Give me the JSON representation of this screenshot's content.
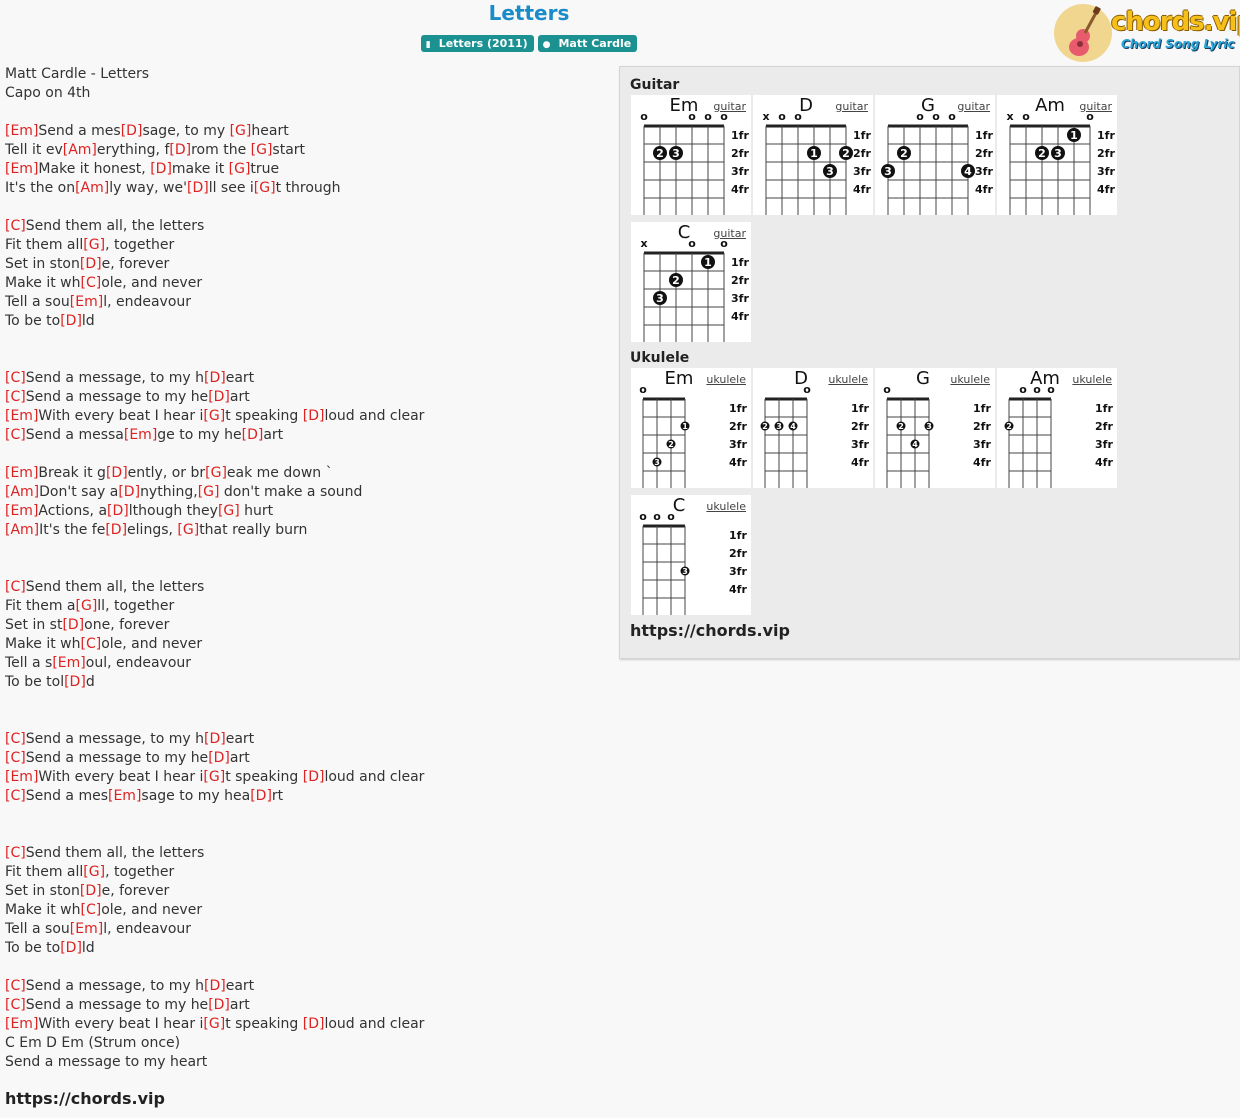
{
  "page": {
    "title": "Letters",
    "tags": [
      {
        "icon": "book-icon",
        "label": "Letters (2011)"
      },
      {
        "icon": "person-icon",
        "label": "Matt Cardle"
      }
    ],
    "logo": {
      "text": "chords.vip",
      "subtitle": "Chord Song Lyric"
    }
  },
  "lyrics": {
    "lines": [
      [
        {
          "t": "Matt Cardle - Letters"
        }
      ],
      [
        {
          "t": "Capo on 4th"
        }
      ],
      [],
      [
        {
          "c": "[Em]"
        },
        {
          "t": "Send a mes"
        },
        {
          "c": "[D]"
        },
        {
          "t": "sage, to my "
        },
        {
          "c": "[G]"
        },
        {
          "t": "heart"
        }
      ],
      [
        {
          "t": "Tell it ev"
        },
        {
          "c": "[Am]"
        },
        {
          "t": "erything, f"
        },
        {
          "c": "[D]"
        },
        {
          "t": "rom the "
        },
        {
          "c": "[G]"
        },
        {
          "t": "start"
        }
      ],
      [
        {
          "c": "[Em]"
        },
        {
          "t": "Make it honest, "
        },
        {
          "c": "[D]"
        },
        {
          "t": "make it "
        },
        {
          "c": "[G]"
        },
        {
          "t": "true"
        }
      ],
      [
        {
          "t": "It's the on"
        },
        {
          "c": "[Am]"
        },
        {
          "t": "ly way, we'"
        },
        {
          "c": "[D]"
        },
        {
          "t": "ll see i"
        },
        {
          "c": "[G]"
        },
        {
          "t": "t through"
        }
      ],
      [],
      [
        {
          "c": "[C]"
        },
        {
          "t": "Send them all, the letters"
        }
      ],
      [
        {
          "t": "Fit them all"
        },
        {
          "c": "[G]"
        },
        {
          "t": ", together"
        }
      ],
      [
        {
          "t": "Set in ston"
        },
        {
          "c": "[D]"
        },
        {
          "t": "e, forever"
        }
      ],
      [
        {
          "t": "Make it wh"
        },
        {
          "c": "[C]"
        },
        {
          "t": "ole, and never"
        }
      ],
      [
        {
          "t": "Tell a sou"
        },
        {
          "c": "[Em]"
        },
        {
          "t": "l, endeavour"
        }
      ],
      [
        {
          "t": "To be to"
        },
        {
          "c": "[D]"
        },
        {
          "t": "ld"
        }
      ],
      [],
      [],
      [
        {
          "c": "[C]"
        },
        {
          "t": "Send a message, to my h"
        },
        {
          "c": "[D]"
        },
        {
          "t": "eart"
        }
      ],
      [
        {
          "c": "[C]"
        },
        {
          "t": "Send a message to my he"
        },
        {
          "c": "[D]"
        },
        {
          "t": "art"
        }
      ],
      [
        {
          "c": "[Em]"
        },
        {
          "t": "With every beat I hear i"
        },
        {
          "c": "[G]"
        },
        {
          "t": "t speaking "
        },
        {
          "c": "[D]"
        },
        {
          "t": "loud and clear"
        }
      ],
      [
        {
          "c": "[C]"
        },
        {
          "t": "Send a messa"
        },
        {
          "c": "[Em]"
        },
        {
          "t": "ge to my he"
        },
        {
          "c": "[D]"
        },
        {
          "t": "art"
        }
      ],
      [],
      [
        {
          "c": "[Em]"
        },
        {
          "t": "Break it g"
        },
        {
          "c": "[D]"
        },
        {
          "t": "ently, or br"
        },
        {
          "c": "[G]"
        },
        {
          "t": "eak me down `"
        }
      ],
      [
        {
          "c": "[Am]"
        },
        {
          "t": "Don't say a"
        },
        {
          "c": "[D]"
        },
        {
          "t": "nything,"
        },
        {
          "c": "[G]"
        },
        {
          "t": " don't make a sound"
        }
      ],
      [
        {
          "c": "[Em]"
        },
        {
          "t": "Actions, a"
        },
        {
          "c": "[D]"
        },
        {
          "t": "lthough they"
        },
        {
          "c": "[G]"
        },
        {
          "t": " hurt"
        }
      ],
      [
        {
          "c": "[Am]"
        },
        {
          "t": "It's the fe"
        },
        {
          "c": "[D]"
        },
        {
          "t": "elings, "
        },
        {
          "c": "[G]"
        },
        {
          "t": "that really burn"
        }
      ],
      [],
      [],
      [
        {
          "c": "[C]"
        },
        {
          "t": "Send them all, the letters"
        }
      ],
      [
        {
          "t": "Fit them a"
        },
        {
          "c": "[G]"
        },
        {
          "t": "ll, together"
        }
      ],
      [
        {
          "t": "Set in st"
        },
        {
          "c": "[D]"
        },
        {
          "t": "one, forever"
        }
      ],
      [
        {
          "t": "Make it wh"
        },
        {
          "c": "[C]"
        },
        {
          "t": "ole, and never"
        }
      ],
      [
        {
          "t": "Tell a s"
        },
        {
          "c": "[Em]"
        },
        {
          "t": "oul, endeavour"
        }
      ],
      [
        {
          "t": "To be tol"
        },
        {
          "c": "[D]"
        },
        {
          "t": "d"
        }
      ],
      [],
      [],
      [
        {
          "c": "[C]"
        },
        {
          "t": "Send a message, to my h"
        },
        {
          "c": "[D]"
        },
        {
          "t": "eart"
        }
      ],
      [
        {
          "c": "[C]"
        },
        {
          "t": "Send a message to my he"
        },
        {
          "c": "[D]"
        },
        {
          "t": "art"
        }
      ],
      [
        {
          "c": "[Em]"
        },
        {
          "t": "With every beat I hear i"
        },
        {
          "c": "[G]"
        },
        {
          "t": "t speaking "
        },
        {
          "c": "[D]"
        },
        {
          "t": "loud and clear"
        }
      ],
      [
        {
          "c": "[C]"
        },
        {
          "t": "Send a mes"
        },
        {
          "c": "[Em]"
        },
        {
          "t": "sage to my hea"
        },
        {
          "c": "[D]"
        },
        {
          "t": "rt"
        }
      ],
      [],
      [],
      [
        {
          "c": "[C]"
        },
        {
          "t": "Send them all, the letters"
        }
      ],
      [
        {
          "t": "Fit them all"
        },
        {
          "c": "[G]"
        },
        {
          "t": ", together"
        }
      ],
      [
        {
          "t": "Set in ston"
        },
        {
          "c": "[D]"
        },
        {
          "t": "e, forever"
        }
      ],
      [
        {
          "t": "Make it wh"
        },
        {
          "c": "[C]"
        },
        {
          "t": "ole, and never"
        }
      ],
      [
        {
          "t": "Tell a sou"
        },
        {
          "c": "[Em]"
        },
        {
          "t": "l, endeavour"
        }
      ],
      [
        {
          "t": "To be to"
        },
        {
          "c": "[D]"
        },
        {
          "t": "ld"
        }
      ],
      [],
      [
        {
          "c": "[C]"
        },
        {
          "t": "Send a message, to my h"
        },
        {
          "c": "[D]"
        },
        {
          "t": "eart"
        }
      ],
      [
        {
          "c": "[C]"
        },
        {
          "t": "Send a message to my he"
        },
        {
          "c": "[D]"
        },
        {
          "t": "art"
        }
      ],
      [
        {
          "c": "[Em]"
        },
        {
          "t": "With every beat I hear i"
        },
        {
          "c": "[G]"
        },
        {
          "t": "t speaking "
        },
        {
          "c": "[D]"
        },
        {
          "t": "loud and clear"
        }
      ],
      [
        {
          "t": "C Em D Em (Strum once)"
        }
      ],
      [
        {
          "t": "Send a message to my heart"
        }
      ]
    ],
    "footer_url": "https://chords.vip"
  },
  "diagrams": {
    "guitar_label": "Guitar",
    "ukulele_label": "Ukulele",
    "fret_labels": [
      "1fr",
      "2fr",
      "3fr",
      "4fr"
    ],
    "guitar": [
      {
        "name": "Em",
        "kind": "guitar",
        "markers": [
          "o",
          "",
          "",
          "o",
          "o",
          "o"
        ],
        "dots": [
          [
            1,
            2,
            "2"
          ],
          [
            2,
            2,
            "3"
          ]
        ]
      },
      {
        "name": "D",
        "kind": "guitar",
        "markers": [
          "x",
          "o",
          "o",
          "",
          "",
          ""
        ],
        "dots": [
          [
            3,
            2,
            "1"
          ],
          [
            5,
            2,
            "2"
          ],
          [
            4,
            3,
            "3"
          ]
        ]
      },
      {
        "name": "G",
        "kind": "guitar",
        "markers": [
          "",
          "",
          "o",
          "o",
          "o",
          ""
        ],
        "dots": [
          [
            1,
            2,
            "2"
          ],
          [
            0,
            3,
            "3"
          ],
          [
            5,
            3,
            "4"
          ]
        ]
      },
      {
        "name": "Am",
        "kind": "guitar",
        "markers": [
          "x",
          "o",
          "",
          "",
          "",
          "o"
        ],
        "dots": [
          [
            4,
            1,
            "1"
          ],
          [
            2,
            2,
            "2"
          ],
          [
            3,
            2,
            "3"
          ]
        ]
      },
      {
        "name": "C",
        "kind": "guitar",
        "markers": [
          "x",
          "",
          "",
          "o",
          "",
          "o"
        ],
        "dots": [
          [
            4,
            1,
            "1"
          ],
          [
            2,
            2,
            "2"
          ],
          [
            1,
            3,
            "3"
          ]
        ]
      }
    ],
    "ukulele": [
      {
        "name": "Em",
        "kind": "ukulele",
        "markers": [
          "o",
          "",
          "",
          ""
        ],
        "dots": [
          [
            3,
            2,
            "1"
          ],
          [
            2,
            3,
            "2"
          ],
          [
            1,
            4,
            "3"
          ]
        ]
      },
      {
        "name": "D",
        "kind": "ukulele",
        "markers": [
          "",
          "",
          "",
          "o"
        ],
        "dots": [
          [
            0,
            2,
            "2"
          ],
          [
            1,
            2,
            "3"
          ],
          [
            2,
            2,
            "4"
          ]
        ]
      },
      {
        "name": "G",
        "kind": "ukulele",
        "markers": [
          "o",
          "",
          "",
          ""
        ],
        "dots": [
          [
            1,
            2,
            "2"
          ],
          [
            3,
            2,
            "3"
          ],
          [
            2,
            3,
            "4"
          ]
        ]
      },
      {
        "name": "Am",
        "kind": "ukulele",
        "markers": [
          "",
          "o",
          "o",
          "o"
        ],
        "dots": [
          [
            0,
            2,
            "2"
          ]
        ]
      },
      {
        "name": "C",
        "kind": "ukulele",
        "markers": [
          "o",
          "o",
          "o",
          ""
        ],
        "dots": [
          [
            3,
            3,
            "3"
          ]
        ]
      }
    ],
    "footer_url": "https://chords.vip"
  }
}
